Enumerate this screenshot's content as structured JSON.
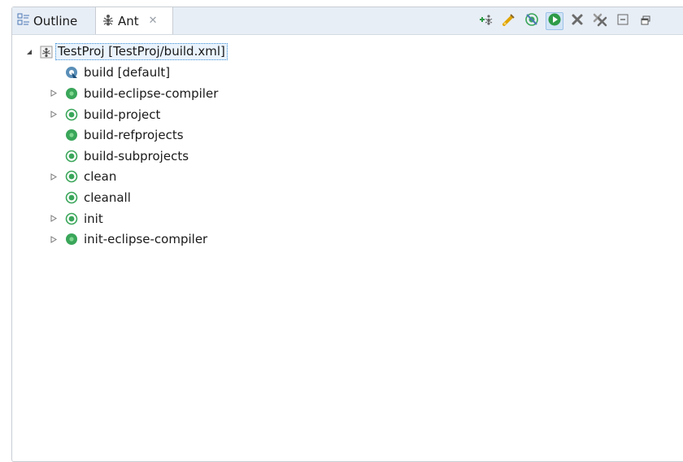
{
  "tabs": [
    {
      "label": "Outline",
      "icon": "outline-icon"
    },
    {
      "label": "Ant",
      "icon": "ant-icon",
      "close": "✕",
      "active": true
    }
  ],
  "toolbar": [
    {
      "name": "add-buildfiles-button",
      "icon": "add-ant-icon"
    },
    {
      "name": "add-with-search-button",
      "icon": "search-buildfile-icon"
    },
    {
      "name": "hide-internal-targets-button",
      "icon": "filter-targets-icon"
    },
    {
      "name": "run-target-button",
      "icon": "run-icon",
      "pressed": true
    },
    {
      "name": "remove-button",
      "icon": "remove-icon"
    },
    {
      "name": "remove-all-button",
      "icon": "remove-all-icon"
    },
    {
      "name": "collapse-all-button",
      "icon": "collapse-all-icon"
    },
    {
      "name": "view-menu-button",
      "icon": "restore-icon"
    }
  ],
  "tree": {
    "root": {
      "label": "TestProj  [TestProj/build.xml]",
      "icon": "ant-buildfile-icon",
      "expanded": true
    },
    "targets": [
      {
        "label": "build [default]",
        "icon": "default-target-icon",
        "expandable": false
      },
      {
        "label": "build-eclipse-compiler",
        "icon": "target-icon",
        "expandable": true
      },
      {
        "label": "build-project",
        "icon": "target-ring-icon",
        "expandable": true
      },
      {
        "label": "build-refprojects",
        "icon": "target-icon",
        "expandable": false
      },
      {
        "label": "build-subprojects",
        "icon": "target-ring-icon",
        "expandable": false
      },
      {
        "label": "clean",
        "icon": "target-ring-icon",
        "expandable": true
      },
      {
        "label": "cleanall",
        "icon": "target-ring-icon",
        "expandable": false
      },
      {
        "label": "init",
        "icon": "target-ring-icon",
        "expandable": true
      },
      {
        "label": "init-eclipse-compiler",
        "icon": "target-icon",
        "expandable": true
      }
    ]
  },
  "colors": {
    "tab_bar": "#e8eef6",
    "target_green": "#3aa65a",
    "selection_border": "#3a8fd8"
  }
}
